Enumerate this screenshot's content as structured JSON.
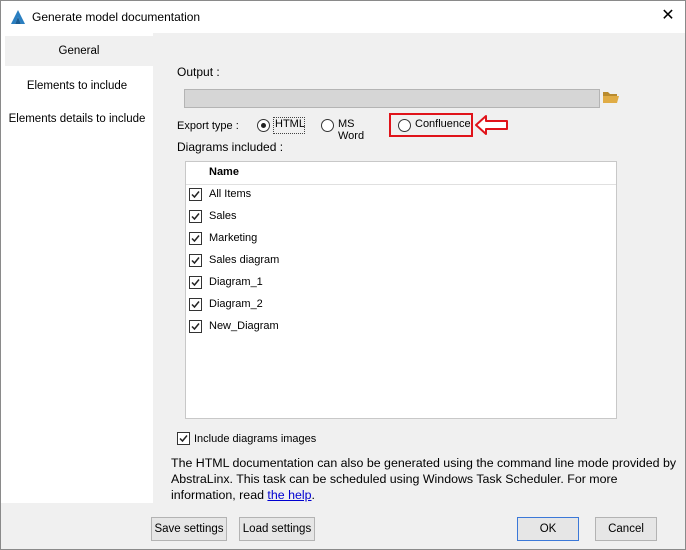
{
  "window": {
    "title": "Generate model documentation",
    "close_label": "✕",
    "accent_color": "#2a7fc1"
  },
  "sidebar": {
    "items": [
      {
        "label": "General",
        "active": true
      },
      {
        "label": "Elements to include",
        "active": false
      },
      {
        "label": "Elements details to include",
        "active": false
      }
    ]
  },
  "output": {
    "label": "Output  :",
    "value": "",
    "browse_icon": "folder-icon"
  },
  "export_type": {
    "label": "Export type :",
    "options": [
      {
        "label": "HTML",
        "selected": true
      },
      {
        "label": "MS Word",
        "selected": false
      },
      {
        "label": "Confluence",
        "selected": false
      }
    ],
    "annotation_color": "#e0131a"
  },
  "diagrams": {
    "label": "Diagrams included :",
    "column_header": "Name",
    "items": [
      {
        "label": "All Items",
        "checked": true
      },
      {
        "label": "Sales",
        "checked": true
      },
      {
        "label": "Marketing",
        "checked": true
      },
      {
        "label": "Sales diagram",
        "checked": true
      },
      {
        "label": "Diagram_1",
        "checked": true
      },
      {
        "label": "Diagram_2",
        "checked": true
      },
      {
        "label": "New_Diagram",
        "checked": true
      }
    ]
  },
  "include_images": {
    "label": "Include diagrams images",
    "checked": true
  },
  "info": {
    "text": "The HTML documentation can also be generated using the command line mode provided by AbstraLinx. This task can be scheduled using Windows Task Scheduler. For more information, read ",
    "link_text": "the help",
    "suffix": "."
  },
  "buttons": {
    "save": "Save settings",
    "load": "Load settings",
    "ok": "OK",
    "cancel": "Cancel"
  }
}
